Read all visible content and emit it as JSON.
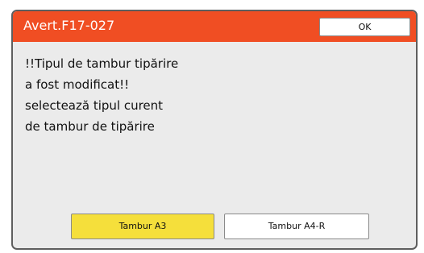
{
  "dialog": {
    "title": "Avert.F17-027",
    "ok_label": "OK",
    "message_lines": [
      "!!Tipul de tambur tipărire",
      "a fost modificat!!",
      "selectează tipul curent",
      "de tambur de tipărire"
    ],
    "options": [
      {
        "label": "Tambur A3",
        "selected": true
      },
      {
        "label": "Tambur A4-R",
        "selected": false
      }
    ]
  },
  "colors": {
    "header": "#f04e23",
    "selected_option": "#f5df3b",
    "dialog_background": "#ebebeb"
  }
}
